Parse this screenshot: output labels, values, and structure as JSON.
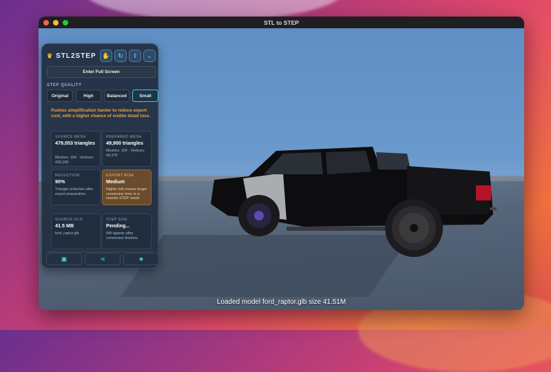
{
  "window": {
    "title": "STL to STEP"
  },
  "panel": {
    "brand": "STL2STEP",
    "fullscreen_label": "Enter Full Screen",
    "quality_label": "STEP QUALITY",
    "quality_options": [
      "Original",
      "High",
      "Balanced",
      "Small"
    ],
    "quality_selected": "Small",
    "warning": "Pushes simplification harder to reduce export cost, with a higher chance of visible detail loss.",
    "cards": {
      "source_mesh": {
        "label": "SOURCE MESH",
        "value": "479,053 triangles",
        "sub": "Meshes: 164 · Vertices: 430,266"
      },
      "prepared_mesh": {
        "label": "PREPARED MESH",
        "value": "49,900 triangles",
        "sub": "Meshes: 164 · Vertices: 40,378"
      },
      "reduction": {
        "label": "REDUCTION",
        "value": "90%",
        "sub": "Triangle reduction after export preparation."
      },
      "export_risk": {
        "label": "EXPORT RISK",
        "value": "Medium",
        "sub": "Higher risk means longer conversion time or a heavier STEP result."
      },
      "source_file": {
        "label": "SOURCE FILE",
        "value": "41.5 MB",
        "sub": "ford_raptor.glb"
      },
      "step_size": {
        "label": "STEP SIZE",
        "value": "Pending...",
        "sub": "Will appear after conversion finishes."
      }
    }
  },
  "viewport": {
    "status": "Loaded model ford_raptor.glb size 41.51M"
  },
  "colors": {
    "accent": "#4ec3e0",
    "warning": "#f0a63a",
    "risk_bg": "#6a4c2c",
    "icon": "#4fe0b8"
  }
}
